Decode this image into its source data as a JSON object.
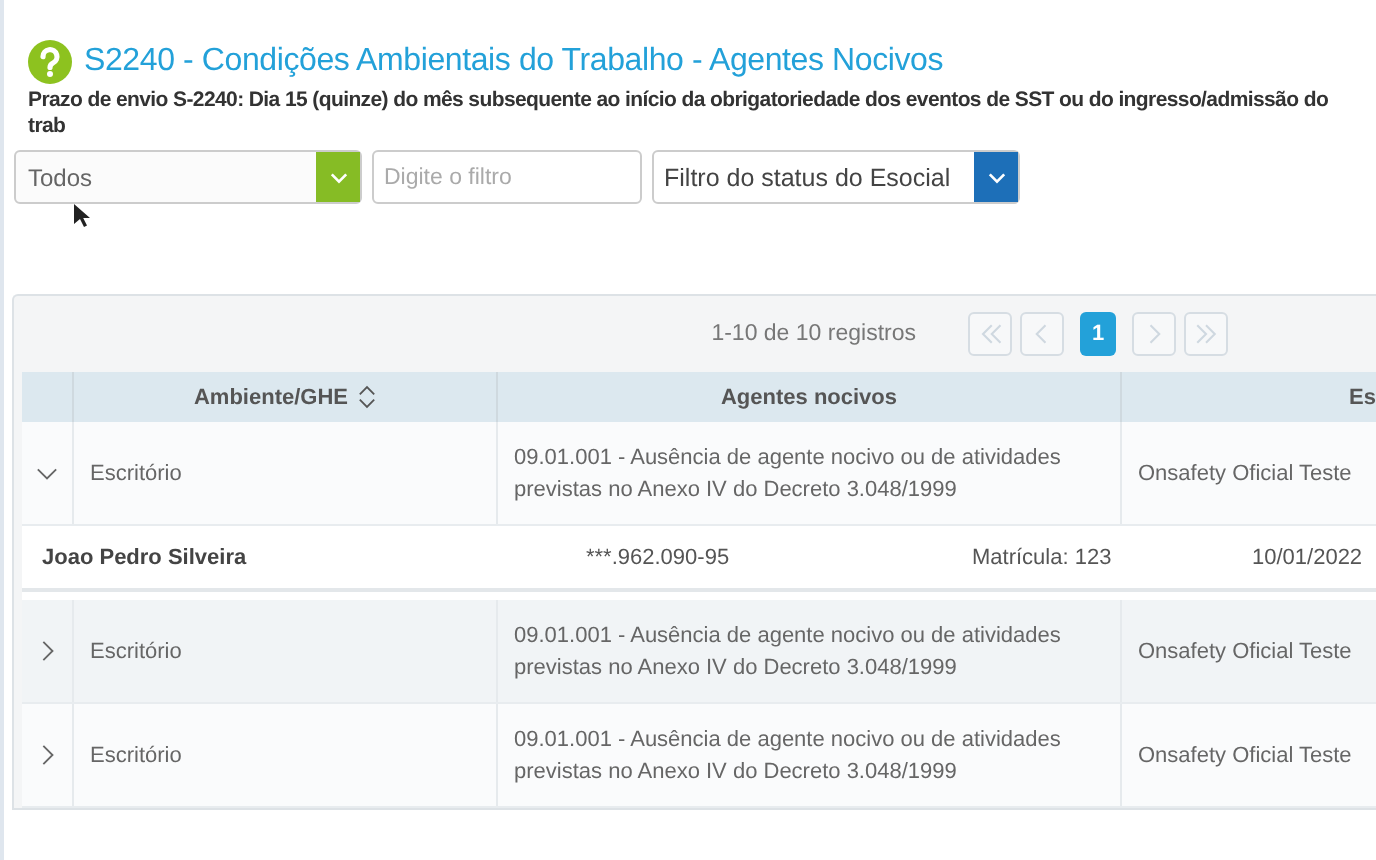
{
  "header": {
    "title": "S2240 - Condições Ambientais do Trabalho - Agentes Nocivos",
    "deadline_note": "Prazo de envio S-2240: Dia 15 (quinze) do mês subsequente ao início da obrigatoriedade dos eventos de SST ou do ingresso/admissão do trab"
  },
  "filters": {
    "status_select": {
      "value": "Todos"
    },
    "text_filter": {
      "placeholder": "Digite o filtro"
    },
    "esocial_select": {
      "placeholder": "Filtro do status do Esocial"
    }
  },
  "pagination": {
    "summary": "1-10 de 10 registros",
    "nav": [
      {
        "kind": "first",
        "disabled": true
      },
      {
        "kind": "prev",
        "disabled": true
      },
      {
        "kind": "next",
        "disabled": true
      },
      {
        "kind": "last",
        "disabled": true
      }
    ],
    "pages": [
      {
        "label": "1",
        "selected": true
      }
    ]
  },
  "table": {
    "columns": [
      {
        "label": "Ambiente/GHE",
        "sortable": true
      },
      {
        "label": "Agentes nocivos",
        "sortable": false
      },
      {
        "label": "Es",
        "sortable": false
      }
    ],
    "rows": [
      {
        "expanded": true,
        "ambiente": "Escritório",
        "agentes": "09.01.001 - Ausência de agente nocivo ou de atividades previstas no Anexo IV do Decreto 3.048/1999",
        "column_3": "Onsafety Oficial Teste",
        "detail": {
          "name": "Joao Pedro Silveira",
          "cpf": "***.962.090-95",
          "registration": "Matrícula: 123",
          "date": "10/01/2022"
        }
      },
      {
        "expanded": false,
        "ambiente": "Escritório",
        "agentes": "09.01.001 - Ausência de agente nocivo ou de atividades previstas no Anexo IV do Decreto 3.048/1999",
        "column_3": "Onsafety Oficial Teste"
      },
      {
        "expanded": false,
        "ambiente": "Escritório",
        "agentes": "09.01.001 - Ausência de agente nocivo ou de atividades previstas no Anexo IV do Decreto 3.048/1999",
        "column_3": "Onsafety Oficial Teste"
      }
    ]
  }
}
